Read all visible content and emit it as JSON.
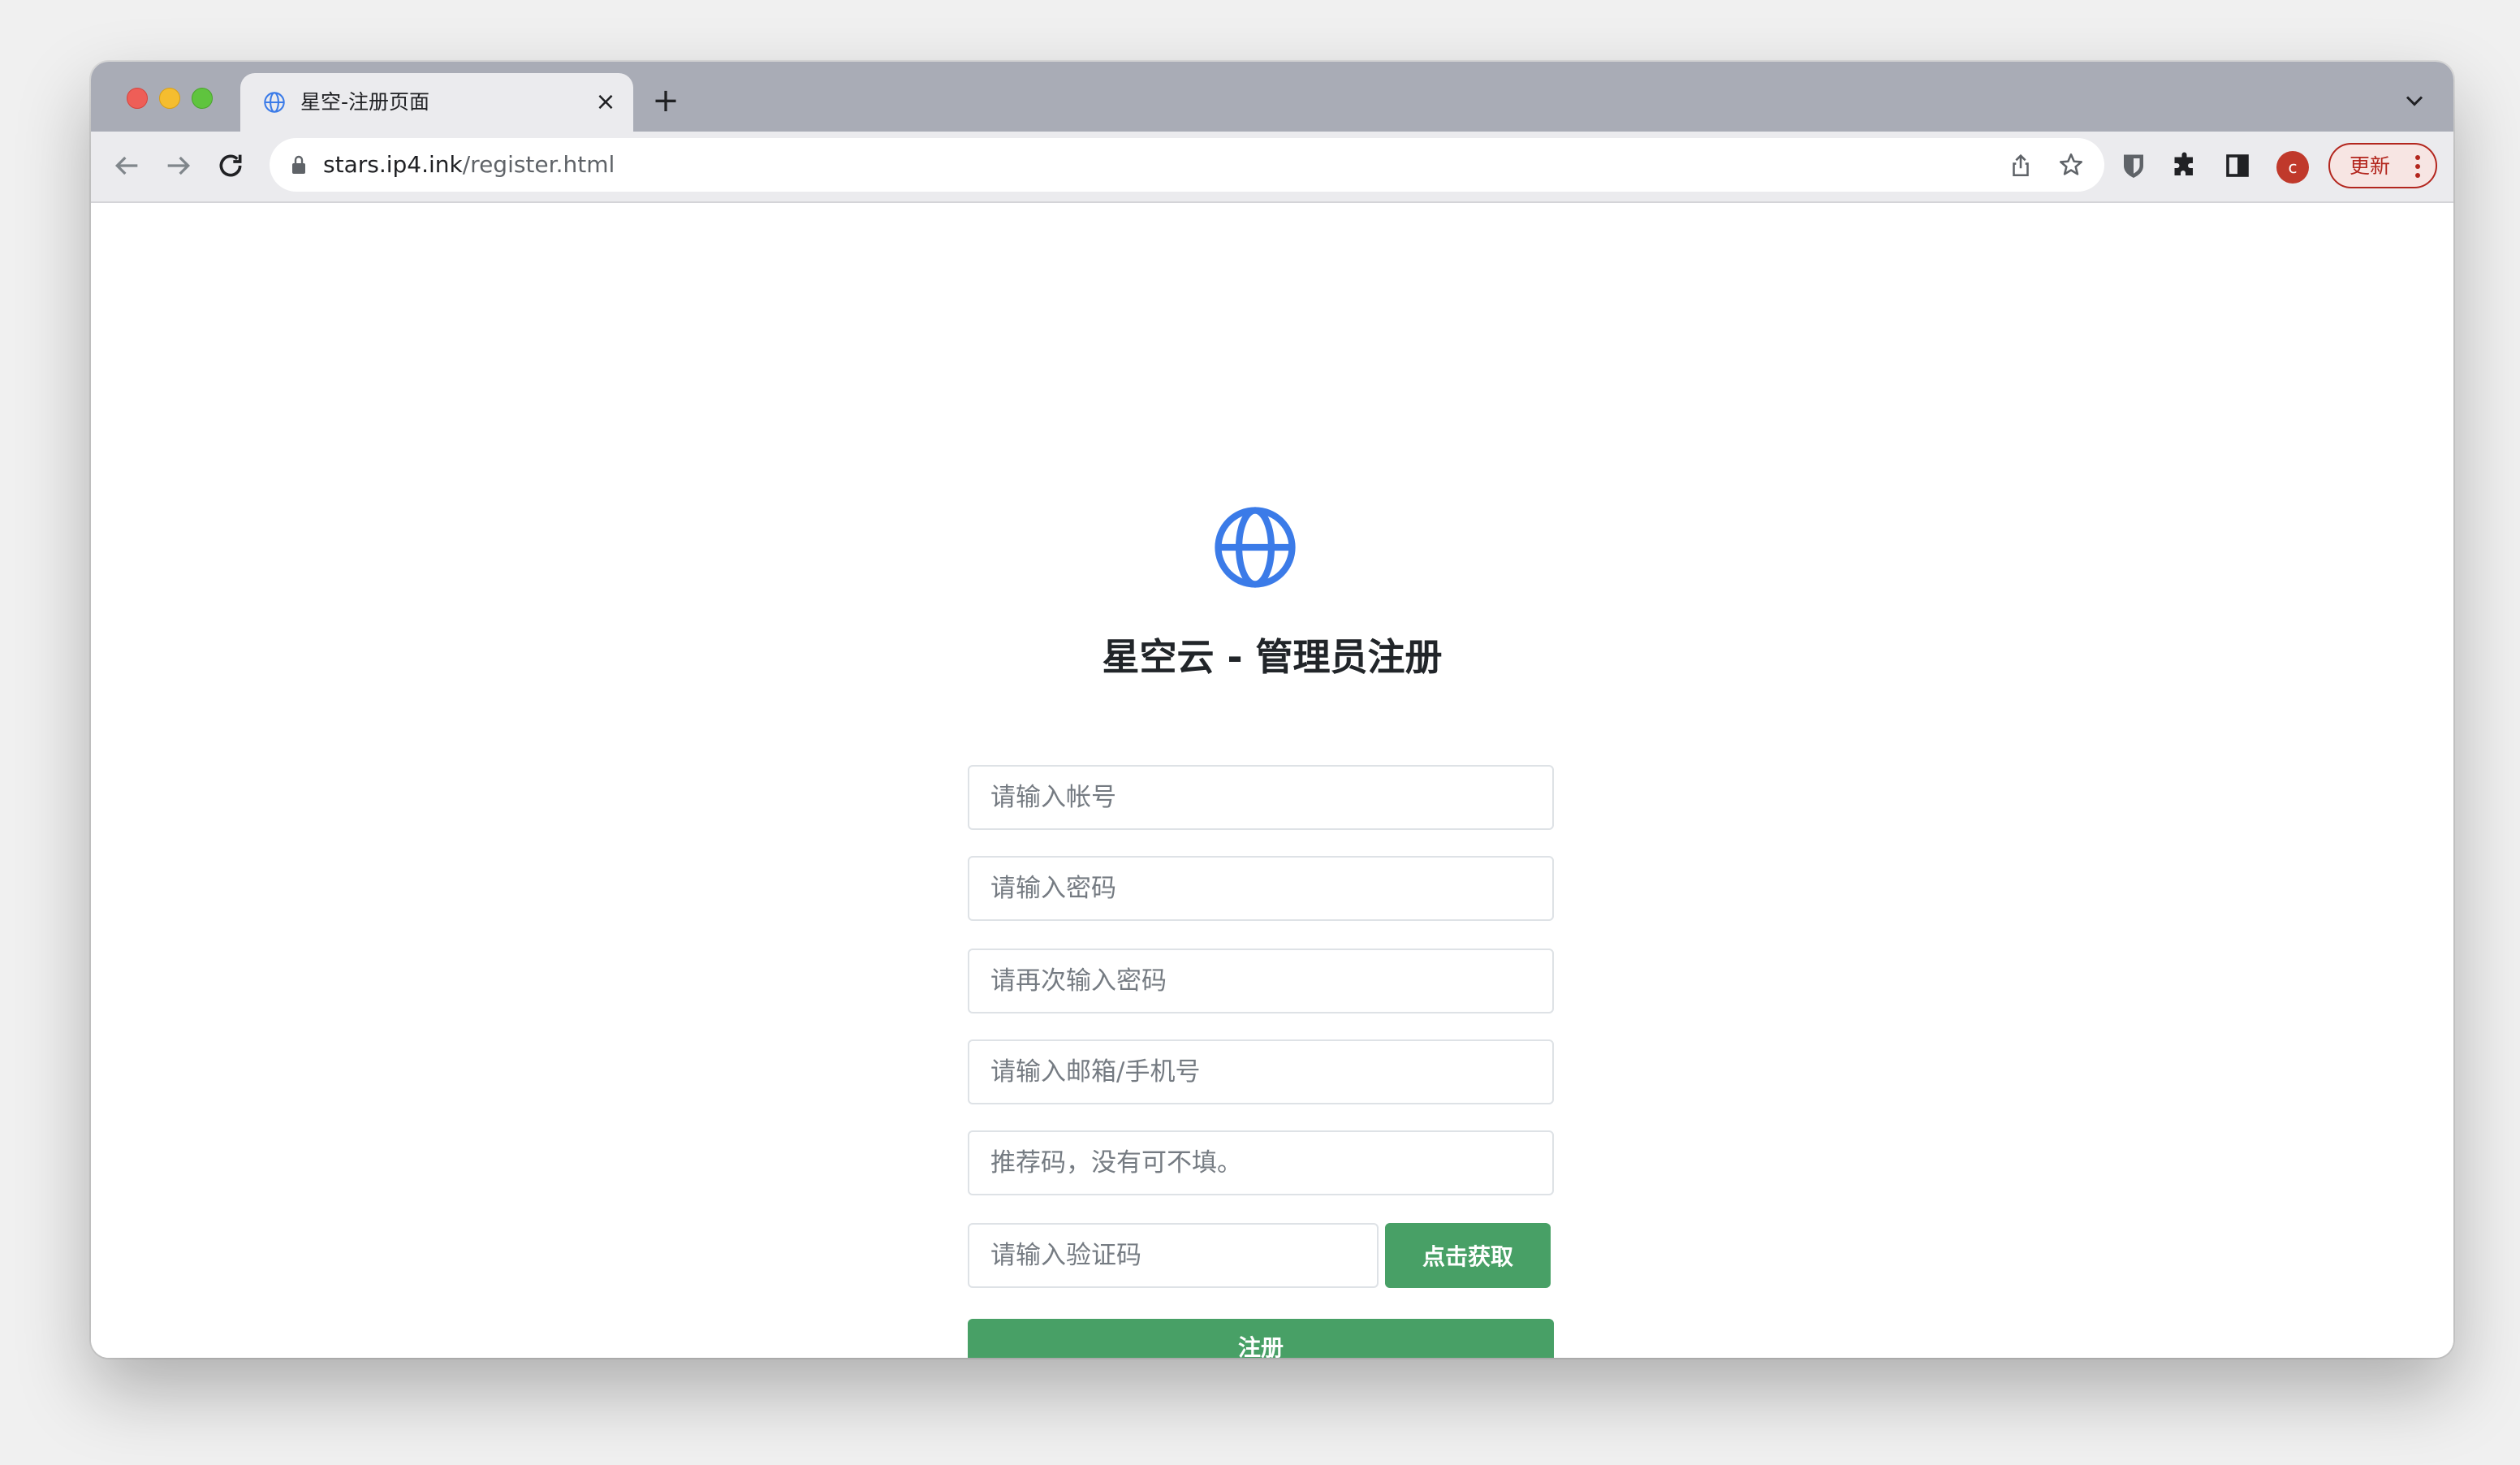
{
  "browser": {
    "tab": {
      "title": "星空-注册页面",
      "close_glyph": "×"
    },
    "new_tab_glyph": "+",
    "address_bar": {
      "host": "stars.ip4.ink",
      "path": "/register.html"
    },
    "profile_initial": "c",
    "update_label": "更新",
    "icons": [
      "globe-icon",
      "close-icon",
      "plus-icon",
      "chevron-down-icon",
      "back-arrow-icon",
      "forward-arrow-icon",
      "reload-icon",
      "lock-icon",
      "share-icon",
      "star-icon",
      "bitwarden-extension-icon",
      "puzzle-extension-icon",
      "side-panel-icon",
      "more-vert-icon"
    ],
    "colors": {
      "tabstrip": "#a9acb6",
      "toolbar": "#ebebee",
      "update_accent": "#b3261e",
      "avatar": "#c0392b"
    }
  },
  "page": {
    "logo_icon": "globe-icon",
    "heading": "星空云 - 管理员注册",
    "form": {
      "account_placeholder": "请输入帐号",
      "password_placeholder": "请输入密码",
      "password_confirm_placeholder": "请再次输入密码",
      "contact_placeholder": "请输入邮箱/手机号",
      "referral_placeholder": "推荐码，没有可不填。",
      "captcha_placeholder": "请输入验证码",
      "get_code_label": "点击获取",
      "submit_label": "注册"
    },
    "colors": {
      "accent": "#48a066",
      "logo": "#3b7be8",
      "heading": "#212529"
    }
  }
}
